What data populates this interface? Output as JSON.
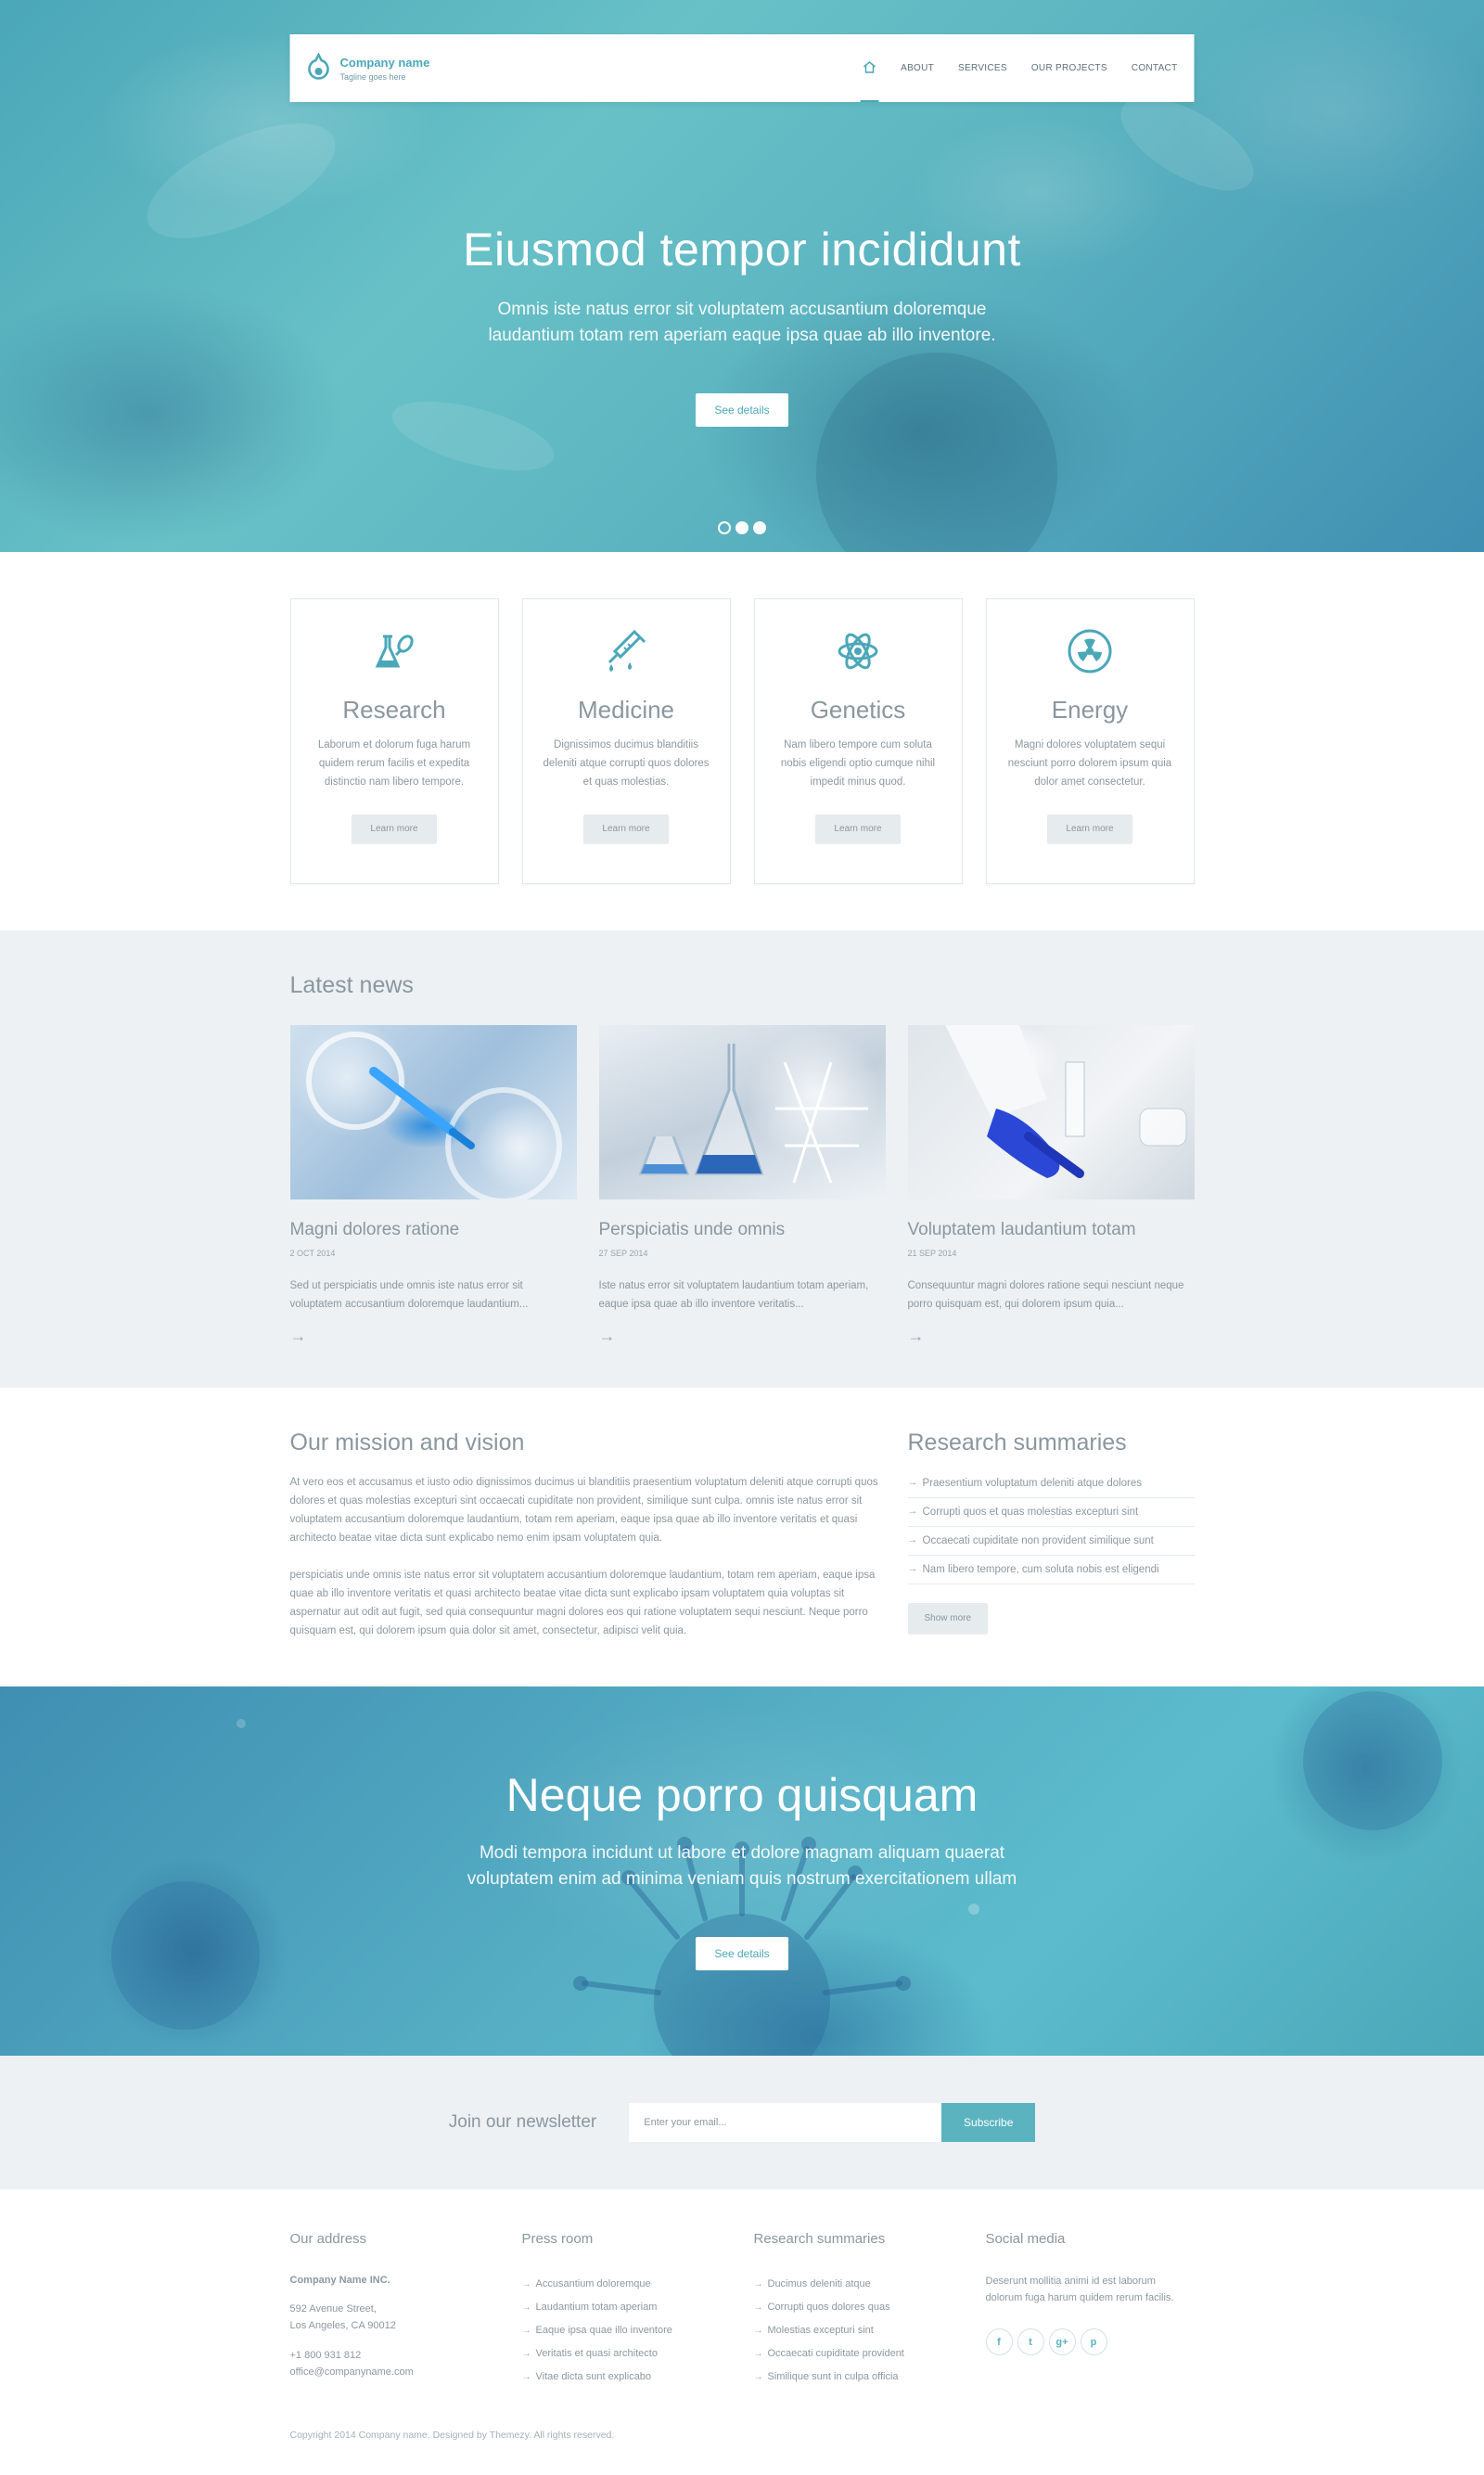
{
  "header": {
    "company_name": "Company name",
    "tagline": "Tagline goes here",
    "nav": [
      {
        "icon": "home-icon"
      },
      {
        "label": "ABOUT"
      },
      {
        "label": "SERVICES"
      },
      {
        "label": "OUR PROJECTS"
      },
      {
        "label": "CONTACT"
      }
    ]
  },
  "hero": {
    "title": "Eiusmod tempor incididunt",
    "subtitle_line1": "Omnis iste natus error sit voluptatem accusantium doloremque",
    "subtitle_line2": "laudantium totam rem aperiam eaque ipsa quae ab illo inventore.",
    "button": "See details",
    "slides": 3,
    "active_slide": 1
  },
  "features": [
    {
      "icon": "flask-icon",
      "title": "Research",
      "text": "Laborum et dolorum fuga harum quidem rerum facilis et expedita distinctio nam libero tempore.",
      "button": "Learn more"
    },
    {
      "icon": "syringe-icon",
      "title": "Medicine",
      "text": "Dignissimos ducimus blanditiis deleniti atque corrupti quos dolores et quas molestias.",
      "button": "Learn more"
    },
    {
      "icon": "atom-icon",
      "title": "Genetics",
      "text": "Nam libero tempore cum soluta nobis eligendi optio cumque nihil impedit minus quod.",
      "button": "Learn more"
    },
    {
      "icon": "radiation-icon",
      "title": "Energy",
      "text": "Magni dolores voluptatem sequi nesciunt porro dolorem ipsum quia dolor amet consectetur.",
      "button": "Learn more"
    }
  ],
  "news": {
    "title": "Latest news",
    "items": [
      {
        "title": "Magni dolores ratione",
        "date": "2 OCT 2014",
        "text": "Sed ut perspiciatis unde omnis iste natus error sit voluptatem accusantium doloremque laudantium..."
      },
      {
        "title": "Perspiciatis unde omnis",
        "date": "27 SEP 2014",
        "text": "Iste natus error sit voluptatem laudantium totam aperiam, eaque ipsa quae ab illo inventore veritatis..."
      },
      {
        "title": "Voluptatem laudantium totam",
        "date": "21 SEP 2014",
        "text": "Consequuntur magni dolores ratione sequi nesciunt neque porro quisquam est, qui dolorem ipsum quia..."
      }
    ]
  },
  "mission": {
    "title": "Our mission and vision",
    "paragraph1": "At vero eos et accusamus et iusto odio dignissimos ducimus ui blanditiis praesentium voluptatum deleniti atque corrupti quos dolores et quas molestias excepturi sint occaecati cupiditate non provident, similique sunt culpa. omnis iste natus error sit voluptatem accusantium doloremque laudantium, totam rem aperiam, eaque ipsa quae ab illo inventore veritatis et quasi architecto beatae vitae dicta sunt explicabo nemo enim ipsam voluptatem quia.",
    "paragraph2": "perspiciatis unde omnis iste natus error sit voluptatem accusantium doloremque laudantium, totam rem aperiam, eaque ipsa quae ab illo inventore veritatis et quasi architecto beatae vitae dicta sunt explicabo ipsam voluptatem quia voluptas sit aspernatur aut odit aut fugit, sed quia consequuntur magni dolores eos qui ratione voluptatem sequi nesciunt. Neque porro quisquam est, qui dolorem ipsum quia dolor sit amet, consectetur, adipisci velit quia."
  },
  "summaries": {
    "title": "Research summaries",
    "items": [
      "Praesentium voluptatum deleniti atque dolores",
      "Corrupti quos et quas molestias excepturi sint",
      "Occaecati cupiditate non provident similique sunt",
      "Nam libero tempore, cum soluta nobis est eligendi"
    ],
    "button": "Show more"
  },
  "cta": {
    "title": "Neque porro quisquam",
    "subtitle_line1": "Modi tempora incidunt ut labore et dolore magnam aliquam quaerat",
    "subtitle_line2": "voluptatem enim ad minima veniam quis nostrum exercitationem ullam",
    "button": "See details"
  },
  "newsletter": {
    "label": "Join our newsletter",
    "placeholder": "Enter your email...",
    "button": "Subscribe"
  },
  "footer": {
    "address": {
      "title": "Our address",
      "company": "Company Name INC.",
      "street": "592 Avenue Street,",
      "city": "Los Angeles, CA 90012",
      "phone": "+1 800 931 812",
      "email": "office@companyname.com"
    },
    "press": {
      "title": "Press room",
      "items": [
        "Accusantium doloremque",
        "Laudantium totam aperiam",
        "Eaque ipsa quae illo inventore",
        "Veritatis et quasi architecto",
        "Vitae dicta sunt explicabo"
      ]
    },
    "research": {
      "title": "Research summaries",
      "items": [
        "Ducimus deleniti atque",
        "Corrupti quos dolores quas",
        "Molestias excepturi sint",
        "Occaecati cupiditate provident",
        "Similique sunt in culpa officia"
      ]
    },
    "social": {
      "title": "Social media",
      "text": "Deserunt mollitia animi id est laborum dolorum fuga harum quidem rerum facilis.",
      "icons": [
        {
          "icon": "facebook-icon",
          "glyph": "f"
        },
        {
          "icon": "twitter-icon",
          "glyph": "t"
        },
        {
          "icon": "google-plus-icon",
          "glyph": "g+"
        },
        {
          "icon": "pinterest-icon",
          "glyph": "p"
        }
      ]
    },
    "copyright": "Copyright 2014 Company name. Designed by Themezy. All rights reserved."
  }
}
